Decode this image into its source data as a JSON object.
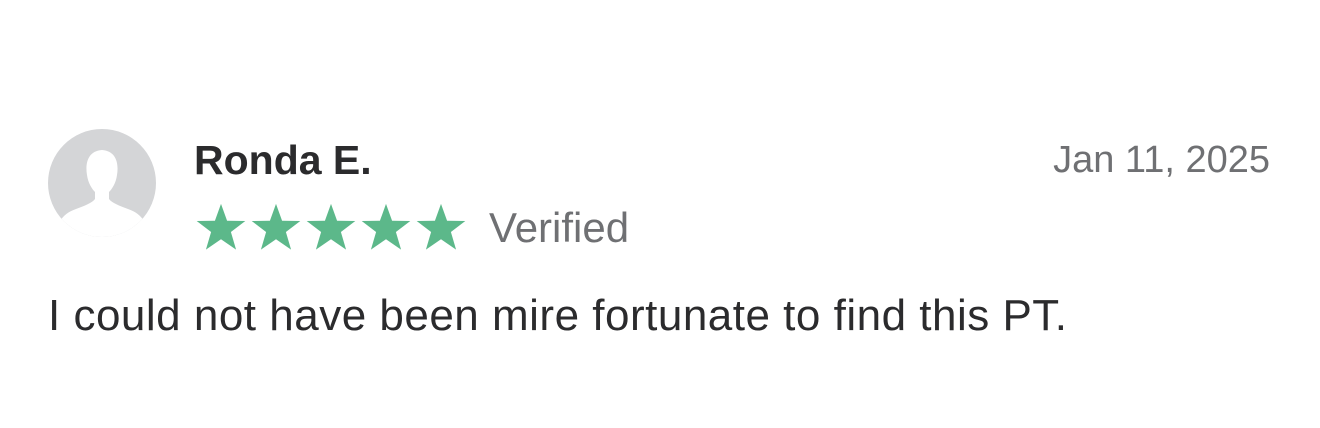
{
  "review": {
    "reviewer_name": "Ronda E.",
    "date": "Jan 11, 2025",
    "rating": 5,
    "rating_max": 5,
    "verified_label": "Verified",
    "text": "I could not have been mire fortunate to find this PT.",
    "avatar_icon": "default-user-silhouette-icon",
    "star_icon": "star-icon"
  },
  "colors": {
    "star": "#5cb88a",
    "avatar_bg": "#d4d5d7",
    "name": "#2b2b2d",
    "muted": "#6f7073"
  }
}
